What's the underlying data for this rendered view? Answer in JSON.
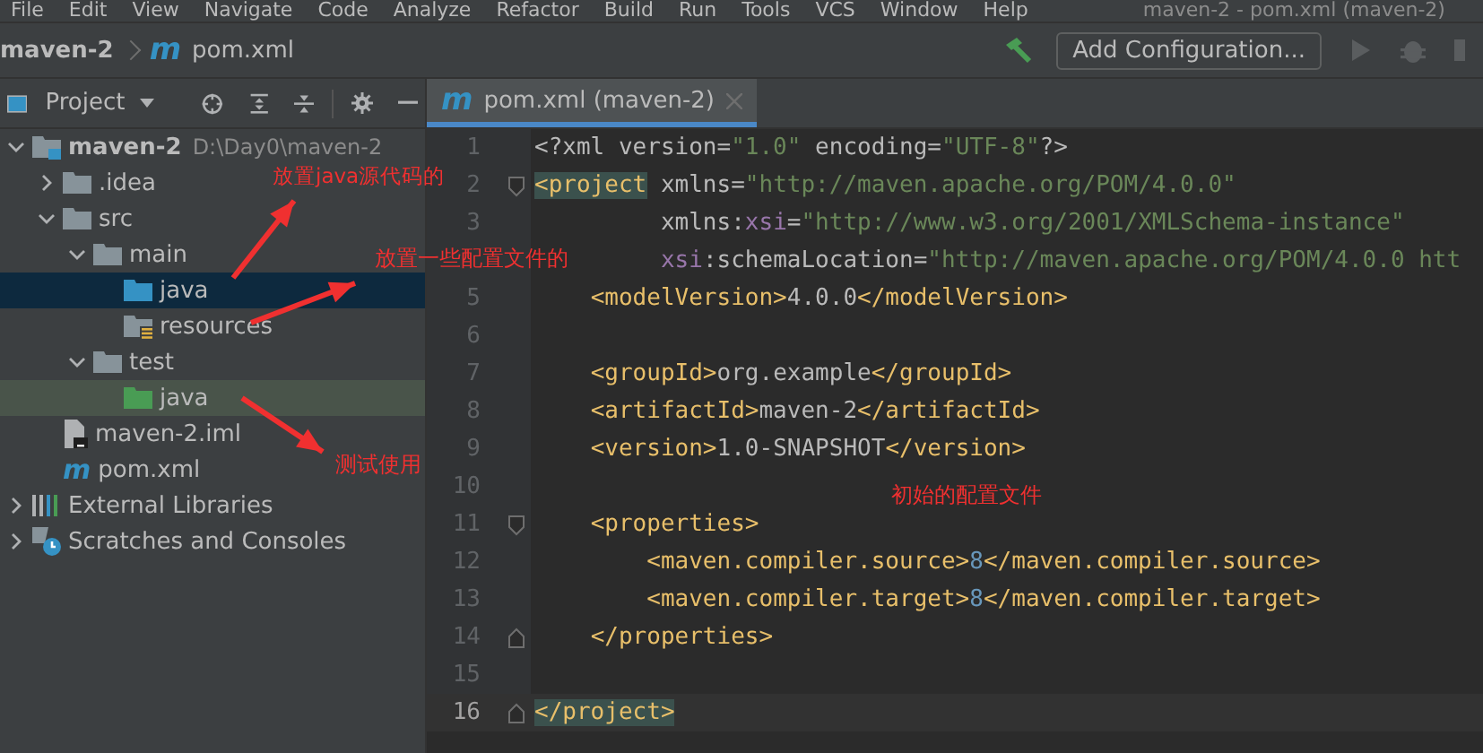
{
  "menu_bar": {
    "items": [
      "File",
      "Edit",
      "View",
      "Navigate",
      "Code",
      "Analyze",
      "Refactor",
      "Build",
      "Run",
      "Tools",
      "VCS",
      "Window",
      "Help"
    ],
    "window_title": "maven-2 - pom.xml (maven-2)"
  },
  "nav_bar": {
    "breadcrumbs": [
      {
        "label": "maven-2",
        "kind": "project"
      },
      {
        "label": "pom.xml",
        "kind": "maven",
        "icon": "m"
      }
    ],
    "config_button": "Add Configuration..."
  },
  "project_panel": {
    "title": "Project",
    "tree": [
      {
        "label": "maven-2",
        "path": "D:\\Day0\\maven-2",
        "kind": "module",
        "expanded": true,
        "selected": false,
        "children": [
          {
            "label": ".idea",
            "kind": "folder",
            "expanded": false,
            "selected": false
          },
          {
            "label": "src",
            "kind": "folder",
            "expanded": true,
            "selected": false,
            "children": [
              {
                "label": "main",
                "kind": "folder",
                "expanded": true,
                "selected": false,
                "children": [
                  {
                    "label": "java",
                    "kind": "source",
                    "selected": true
                  },
                  {
                    "label": "resources",
                    "kind": "resources",
                    "selected": false
                  }
                ]
              },
              {
                "label": "test",
                "kind": "folder",
                "expanded": true,
                "selected": false,
                "children": [
                  {
                    "label": "java",
                    "kind": "test-source",
                    "selected": false
                  }
                ]
              }
            ]
          },
          {
            "label": "maven-2.iml",
            "kind": "iml",
            "selected": false
          },
          {
            "label": "pom.xml",
            "kind": "maven",
            "icon": "m",
            "selected": false
          }
        ]
      },
      {
        "label": "External Libraries",
        "kind": "libraries",
        "expanded": false,
        "selected": false
      },
      {
        "label": "Scratches and Consoles",
        "kind": "scratches",
        "expanded": false,
        "selected": false
      }
    ]
  },
  "editor": {
    "tab": {
      "label": "pom.xml (maven-2)",
      "icon": "m",
      "selected": true
    },
    "lines": [
      {
        "number": "1",
        "current": false,
        "fold_start": false,
        "fold_end": false,
        "segments": [
          {
            "kind": "plain",
            "text": "<?xml version="
          },
          {
            "kind": "value",
            "text": "\"1.0\""
          },
          {
            "kind": "plain",
            "text": " encoding="
          },
          {
            "kind": "value",
            "text": "\"UTF-8\""
          },
          {
            "kind": "plain",
            "text": "?>"
          }
        ]
      },
      {
        "number": "2",
        "current": false,
        "fold_start": true,
        "fold_end": false,
        "segments": [
          {
            "kind": "match",
            "text": "<project"
          },
          {
            "kind": "attr",
            "text": " xmlns="
          },
          {
            "kind": "value",
            "text": "\"http://maven.apache.org/POM/4.0.0\""
          }
        ]
      },
      {
        "number": "3",
        "current": false,
        "fold_start": false,
        "fold_end": false,
        "segments": [
          {
            "kind": "attr",
            "text": "         xmlns:"
          },
          {
            "kind": "ns",
            "text": "xsi"
          },
          {
            "kind": "attr",
            "text": "="
          },
          {
            "kind": "value",
            "text": "\"http://www.w3.org/2001/XMLSchema-instance\""
          }
        ]
      },
      {
        "current": false,
        "fold_start": false,
        "fold_end": false,
        "segments": [
          {
            "kind": "ns",
            "text": "         xsi"
          },
          {
            "kind": "attr",
            "text": ":schemaLocation="
          },
          {
            "kind": "value",
            "text": "\"http://maven.apache.org/POM/4.0.0 htt"
          }
        ]
      },
      {
        "number": "5",
        "current": false,
        "fold_start": false,
        "fold_end": false,
        "segments": [
          {
            "kind": "tag",
            "text": "    <modelVersion>"
          },
          {
            "kind": "plain",
            "text": "4.0.0"
          },
          {
            "kind": "tag",
            "text": "</modelVersion>"
          }
        ]
      },
      {
        "number": "6",
        "current": false,
        "fold_start": false,
        "fold_end": false
      },
      {
        "number": "7",
        "current": false,
        "fold_start": false,
        "fold_end": false,
        "segments": [
          {
            "kind": "tag",
            "text": "    <groupId>"
          },
          {
            "kind": "plain",
            "text": "org.example"
          },
          {
            "kind": "tag",
            "text": "</groupId>"
          }
        ]
      },
      {
        "number": "8",
        "current": false,
        "fold_start": false,
        "fold_end": false,
        "segments": [
          {
            "kind": "tag",
            "text": "    <artifactId>"
          },
          {
            "kind": "plain",
            "text": "maven-2"
          },
          {
            "kind": "tag",
            "text": "</artifactId>"
          }
        ]
      },
      {
        "number": "9",
        "current": false,
        "fold_start": false,
        "fold_end": false,
        "segments": [
          {
            "kind": "tag",
            "text": "    <version>"
          },
          {
            "kind": "plain",
            "text": "1.0-SNAPSHOT"
          },
          {
            "kind": "tag",
            "text": "</version>"
          }
        ]
      },
      {
        "number": "10",
        "current": false,
        "fold_start": false,
        "fold_end": false
      },
      {
        "number": "11",
        "current": false,
        "fold_start": true,
        "fold_end": false,
        "segments": [
          {
            "kind": "tag",
            "text": "    <properties>"
          }
        ]
      },
      {
        "number": "12",
        "current": false,
        "fold_start": false,
        "fold_end": false,
        "segments": [
          {
            "kind": "tag",
            "text": "        <maven.compiler.source>"
          },
          {
            "kind": "number",
            "text": "8"
          },
          {
            "kind": "tag",
            "text": "</maven.compiler.source>"
          }
        ]
      },
      {
        "number": "13",
        "current": false,
        "fold_start": false,
        "fold_end": false,
        "segments": [
          {
            "kind": "tag",
            "text": "        <maven.compiler.target>"
          },
          {
            "kind": "number",
            "text": "8"
          },
          {
            "kind": "tag",
            "text": "</maven.compiler.target>"
          }
        ]
      },
      {
        "number": "14",
        "current": false,
        "fold_start": false,
        "fold_end": true,
        "segments": [
          {
            "kind": "tag",
            "text": "    </properties>"
          }
        ]
      },
      {
        "number": "15",
        "current": false,
        "fold_start": false,
        "fold_end": false
      },
      {
        "number": "16",
        "current": true,
        "fold_start": false,
        "fold_end": true,
        "segments": [
          {
            "kind": "match",
            "text": "</project>"
          }
        ]
      }
    ]
  },
  "annotations": [
    {
      "text": "放置java源代码的",
      "arrow": true
    },
    {
      "text": "放置一些配置文件的",
      "arrow": true
    },
    {
      "text": "测试使用",
      "arrow": true
    },
    {
      "text": "初始的配置文件",
      "arrow": false
    }
  ]
}
